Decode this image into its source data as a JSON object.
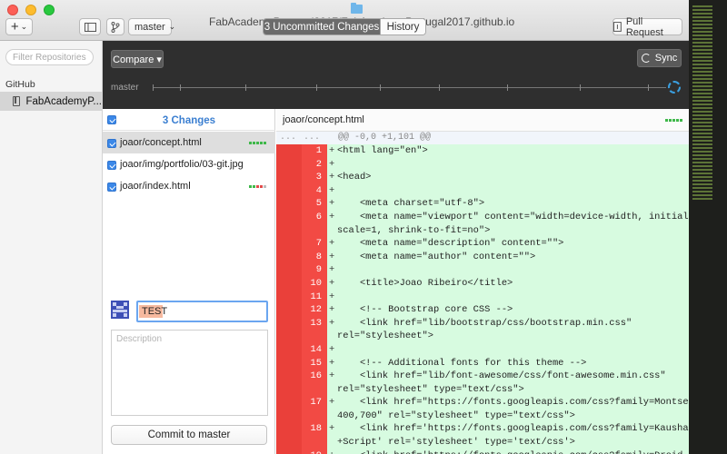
{
  "window": {
    "title": "FabAcademyPortugal2017/FabAcademyPortugal2017.github.io"
  },
  "toolbar": {
    "add_label": "+",
    "add_chevron": "⌄",
    "branch_name": "master",
    "branch_chevron": "⌄",
    "tabs": [
      {
        "label": "3 Uncommitted Changes"
      },
      {
        "label": "History"
      }
    ],
    "pull_request_label": "Pull Request"
  },
  "sidebar": {
    "filter_placeholder": "Filter Repositories",
    "section_label": "GitHub",
    "repo_name": "FabAcademyP..."
  },
  "branchbar": {
    "compare_label": "Compare ▾",
    "sync_label": "Sync",
    "branch_label": "master"
  },
  "changes": {
    "title": "3 Changes",
    "files": [
      {
        "name": "joaor/concept.html",
        "stat": [
          "#3fb84a",
          "#3fb84a",
          "#3fb84a",
          "#3fb84a",
          "#3fb84a"
        ]
      },
      {
        "name": "joaor/img/portfolio/03-git.jpg",
        "stat": []
      },
      {
        "name": "joaor/index.html",
        "stat": [
          "#3fb84a",
          "#3fb84a",
          "#e24b4b",
          "#e24b4b",
          "#bdbdbd"
        ]
      }
    ],
    "summary_value": "TEST",
    "description_placeholder": "Description",
    "commit_label": "Commit to master"
  },
  "diff": {
    "filename": "joaor/concept.html",
    "hunk_old": "...",
    "hunk_new": "...",
    "hunk_header": "@@ -0,0 +1,101 @@",
    "lines": [
      {
        "n": "1",
        "p": "+",
        "t": "<html lang=\"en\">"
      },
      {
        "n": "2",
        "p": "+",
        "t": ""
      },
      {
        "n": "3",
        "p": "+",
        "t": "<head>"
      },
      {
        "n": "4",
        "p": "+",
        "t": ""
      },
      {
        "n": "5",
        "p": "+",
        "t": "    <meta charset=\"utf-8\">"
      },
      {
        "n": "6",
        "p": "+",
        "t": "    <meta name=\"viewport\" content=\"width=device-width, initial-"
      },
      {
        "n": "",
        "p": "",
        "t": "scale=1, shrink-to-fit=no\">"
      },
      {
        "n": "7",
        "p": "+",
        "t": "    <meta name=\"description\" content=\"\">"
      },
      {
        "n": "8",
        "p": "+",
        "t": "    <meta name=\"author\" content=\"\">"
      },
      {
        "n": "9",
        "p": "+",
        "t": ""
      },
      {
        "n": "10",
        "p": "+",
        "t": "    <title>Joao Ribeiro</title>"
      },
      {
        "n": "11",
        "p": "+",
        "t": ""
      },
      {
        "n": "12",
        "p": "+",
        "t": "    <!-- Bootstrap core CSS -->"
      },
      {
        "n": "13",
        "p": "+",
        "t": "    <link href=\"lib/bootstrap/css/bootstrap.min.css\""
      },
      {
        "n": "",
        "p": "",
        "t": "rel=\"stylesheet\">"
      },
      {
        "n": "14",
        "p": "+",
        "t": ""
      },
      {
        "n": "15",
        "p": "+",
        "t": "    <!-- Additional fonts for this theme -->"
      },
      {
        "n": "16",
        "p": "+",
        "t": "    <link href=\"lib/font-awesome/css/font-awesome.min.css\""
      },
      {
        "n": "",
        "p": "",
        "t": "rel=\"stylesheet\" type=\"text/css\">"
      },
      {
        "n": "17",
        "p": "+",
        "t": "    <link href=\"https://fonts.googleapis.com/css?family=Montserrat:"
      },
      {
        "n": "",
        "p": "",
        "t": "400,700\" rel=\"stylesheet\" type=\"text/css\">"
      },
      {
        "n": "18",
        "p": "+",
        "t": "    <link href='https://fonts.googleapis.com/css?family=Kaushan"
      },
      {
        "n": "",
        "p": "",
        "t": "+Script' rel='stylesheet' type='text/css'>"
      },
      {
        "n": "19",
        "p": "+",
        "t": "    <link href='https://fonts.googleapis.com/css?family=Droid"
      }
    ]
  },
  "colors": {
    "accent": "#3b7fd1",
    "added_bg": "#d7fbe0",
    "gutter_red": "#f24a44",
    "active_tab": "#6b6b6b"
  },
  "icons": {
    "add": "plus-icon",
    "sidebar": "sidebar-toggle-icon",
    "branch": "branch-icon",
    "pull_request": "pull-request-icon",
    "sync": "sync-icon",
    "repo": "repo-icon",
    "folder": "folder-icon"
  }
}
